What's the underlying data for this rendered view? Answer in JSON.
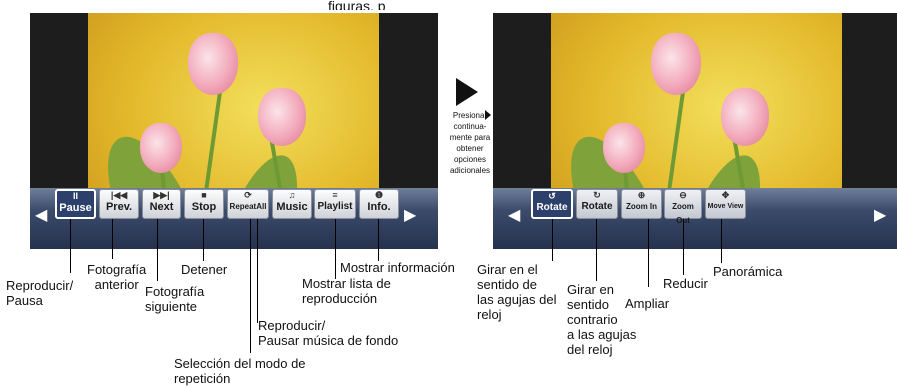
{
  "top_caption": "figuras, p",
  "left_screen": {
    "buttons": [
      {
        "icon": "II",
        "label": "Pause"
      },
      {
        "icon": "|◀◀",
        "label": "Prev."
      },
      {
        "icon": "▶▶|",
        "label": "Next"
      },
      {
        "icon": "■",
        "label": "Stop"
      },
      {
        "icon": "⟳",
        "label": "RepeatAll"
      },
      {
        "icon": "♫",
        "label": "Music"
      },
      {
        "icon": "≡",
        "label": "Playlist"
      },
      {
        "icon": "❶",
        "label": "Info."
      }
    ],
    "left_arrow": "◀",
    "right_arrow": "▶"
  },
  "right_screen": {
    "buttons": [
      {
        "icon": "↺",
        "label": "Rotate"
      },
      {
        "icon": "↻",
        "label": "Rotate"
      },
      {
        "icon": "⊕",
        "label": "Zoom In"
      },
      {
        "icon": "⊖",
        "label": "Zoom Out"
      },
      {
        "icon": "✥",
        "label": "Move View"
      }
    ],
    "left_arrow": "◀",
    "right_arrow": "▶"
  },
  "middle_note": [
    "Presionar",
    "continua-",
    "mente para",
    "obtener",
    "opciones",
    "adicionales"
  ],
  "labels": {
    "play_pause": [
      "Reproducir/",
      "Pausa"
    ],
    "prev_photo": [
      "Fotografía",
      "anterior"
    ],
    "next_photo": [
      "Fotografía",
      "siguiente"
    ],
    "stop": "Detener",
    "repeat": [
      "Selección del modo de",
      "repetición"
    ],
    "music": [
      "Reproducir/",
      "Pausar música de fondo"
    ],
    "playlist": [
      "Mostrar lista de",
      "reproducción"
    ],
    "info": "Mostrar información",
    "rotate_cw": [
      "Girar en el",
      "sentido de",
      "las agujas del",
      "reloj"
    ],
    "rotate_ccw": [
      "Girar en",
      "sentido",
      "contrario",
      "a las agujas",
      "del reloj"
    ],
    "zoom_in": "Ampliar",
    "zoom_out": "Reducir",
    "move_view": "Panorámica"
  }
}
